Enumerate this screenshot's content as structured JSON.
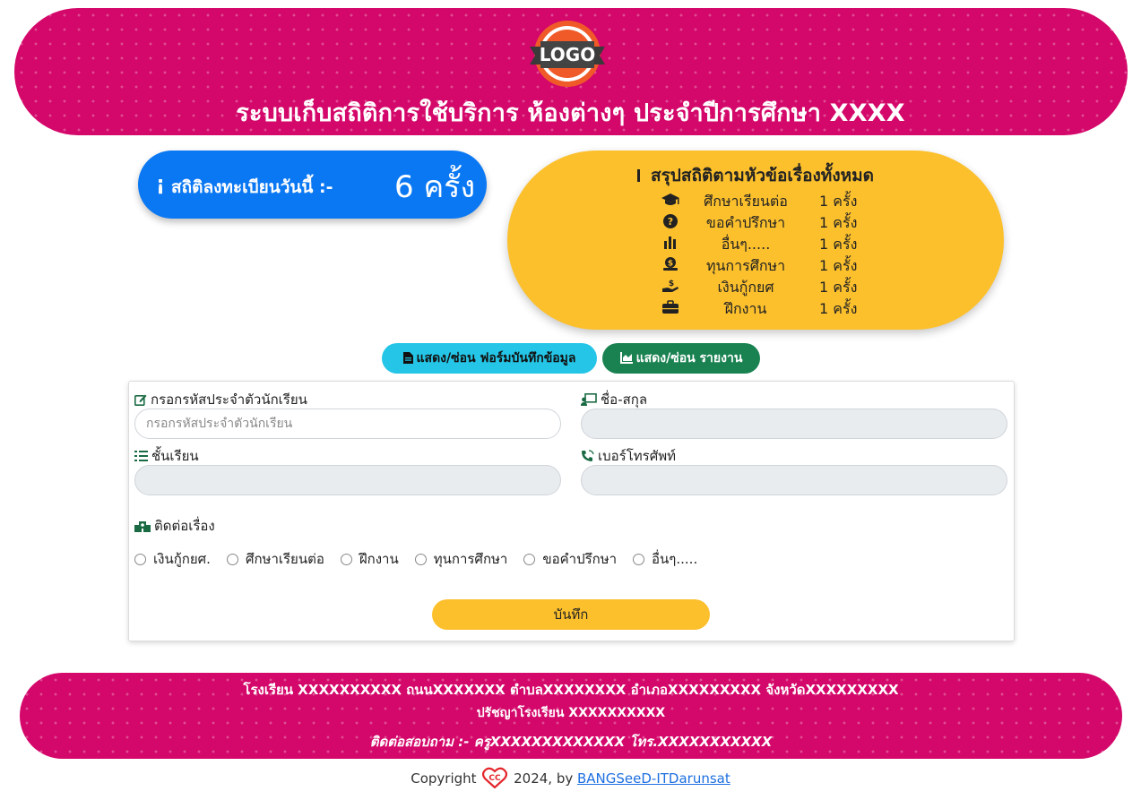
{
  "header": {
    "logo_text": "LOGO",
    "title": "ระบบเก็บสถิติการใช้บริการ ห้องต่างๆ ประจำปีการศึกษา XXXX"
  },
  "today_stats": {
    "label": "สถิติลงทะเบียนวันนี้ :-",
    "count": "6 ครั้ง"
  },
  "summary": {
    "title": "สรุปสถิติตามหัวข้อเรื่องทั้งหมด",
    "rows": [
      {
        "icon": "graduation-cap-icon",
        "name": "ศึกษาเรียนต่อ",
        "count": "1 ครั้ง"
      },
      {
        "icon": "question-circle-icon",
        "name": "ขอคำปรึกษา",
        "count": "1 ครั้ง"
      },
      {
        "icon": "bar-chart-icon",
        "name": "อื่นๆ.....",
        "count": "1 ครั้ง"
      },
      {
        "icon": "money-bag-icon",
        "name": "ทุนการศึกษา",
        "count": "1 ครั้ง"
      },
      {
        "icon": "hand-holding-dollar-icon",
        "name": "เงินกู้กยศ",
        "count": "1 ครั้ง"
      },
      {
        "icon": "briefcase-icon",
        "name": "ฝึกงาน",
        "count": "1 ครั้ง"
      }
    ]
  },
  "toggles": {
    "form_label": "แสดง/ซ่อน ฟอร์มบันทึกข้อมูล",
    "report_label": "แสดง/ซ่อน รายงาน"
  },
  "form": {
    "student_id_label": "กรอกรหัสประจำตัวนักเรียน",
    "student_id_placeholder": "กรอกรหัสประจำตัวนักเรียน",
    "student_id_value": "",
    "name_label": "ชื่อ-สกุล",
    "name_value": "",
    "class_label": "ชั้นเรียน",
    "class_value": "",
    "phone_label": "เบอร์โทรศัพท์",
    "phone_value": "",
    "topic_label": "ติดต่อเรื่อง",
    "topics": [
      "เงินกู้กยศ.",
      "ศึกษาเรียนต่อ",
      "ฝึกงาน",
      "ทุนการศึกษา",
      "ขอคำปรึกษา",
      "อื่นๆ....."
    ],
    "save_label": "บันทึก"
  },
  "footer": {
    "address": "โรงเรียน XXXXXXXXXX ถนนXXXXXXX ตำบลXXXXXXXX อำเภอXXXXXXXXX จังหวัดXXXXXXXXX",
    "motto": "ปรัชญาโรงเรียน XXXXXXXXXX",
    "contact": "ติดต่อสอบถาม :- ครูXXXXXXXXXXXXX โทร.XXXXXXXXXXX"
  },
  "copyright": {
    "prefix": "Copyright",
    "suffix": "2024, by",
    "link_text": "BANGSeeD-ITDarunsat"
  },
  "colors": {
    "header_pink": "#d4076a",
    "blue": "#0b78f3",
    "yellow": "#fcc02d",
    "cyan": "#24c5e6",
    "green": "#1a8251"
  }
}
